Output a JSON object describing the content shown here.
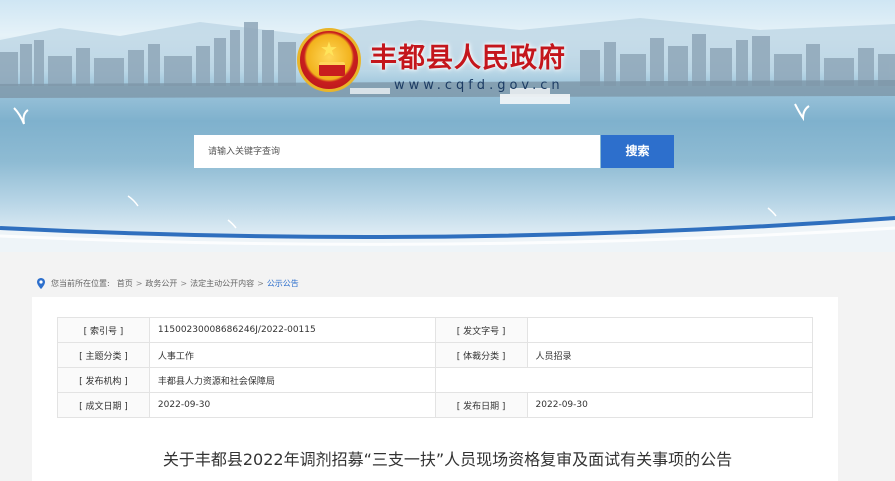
{
  "header": {
    "site_title": "丰都县人民政府",
    "site_domain": "www.cqfd.gov.cn"
  },
  "search": {
    "placeholder": "请输入关键字查询",
    "button_label": "搜索"
  },
  "breadcrumb": {
    "prefix": "您当前所在位置:",
    "items": [
      "首页",
      "政务公开",
      "法定主动公开内容",
      "公示公告"
    ],
    "separator": ">"
  },
  "meta_table": {
    "rows": [
      [
        "[ 索引号 ]",
        "11500230008686246J/2022-00115",
        "[ 发文字号 ]",
        ""
      ],
      [
        "[ 主题分类 ]",
        "人事工作",
        "[ 体裁分类 ]",
        "人员招录"
      ],
      [
        "[ 发布机构 ]",
        "丰都县人力资源和社会保障局",
        "",
        ""
      ],
      [
        "[ 成文日期 ]",
        "2022-09-30",
        "[ 发布日期 ]",
        "2022-09-30"
      ]
    ]
  },
  "article": {
    "title": "关于丰都县2022年调剂招募“三支一扶”人员现场资格复审及面试有关事项的公告"
  },
  "colors": {
    "accent": "#2d6fcc",
    "title_red": "#c4161c",
    "page_bg": "#f3f3f3"
  }
}
